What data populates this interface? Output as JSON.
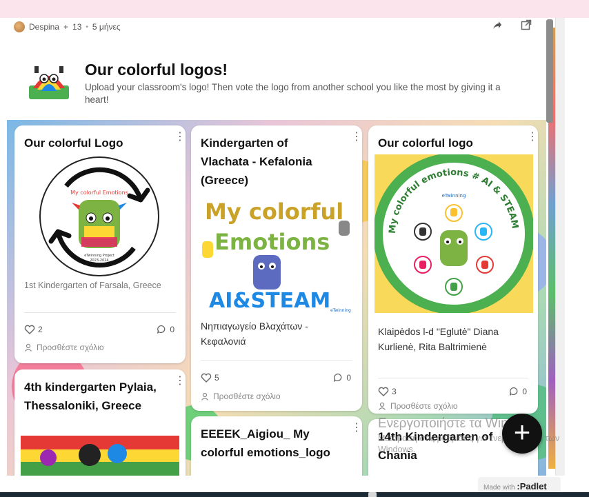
{
  "meta": {
    "author": "Despina",
    "plus": "+",
    "count": "13",
    "separator": "•",
    "age": "5 μήνες"
  },
  "header": {
    "title": "Our colorful logos!",
    "description": "Upload your classroom's logo! Then vote the logo from another school you like the most by giving it a heart!"
  },
  "cards": [
    {
      "title": "Our colorful Logo",
      "caption": "1st Kindergarten of Farsala, Greece",
      "likes": "2",
      "comments": "0",
      "comment_placeholder": "Προσθέστε σχόλιο",
      "logo_text": {
        "line1": "My colorful Emotions",
        "line2": "eTwinning Project",
        "line3": "2023-2024"
      }
    },
    {
      "title": "Kindergarten of Vlachata - Kefalonia (Greece)",
      "caption": "Νηπιαγωγείο Βλαχάτων - Κεφαλονιά",
      "likes": "5",
      "comments": "0",
      "comment_placeholder": "Προσθέστε σχόλιο",
      "logo_text": {
        "line1": "My colorful",
        "line2": "Emotions",
        "line3": "AI&STEAM",
        "badge": "eTwinning"
      }
    },
    {
      "title": "Our colorful logo",
      "caption": "Klaipėdos l-d \"Eglutė\" Diana Kurlienė, Rita Baltrimienė",
      "likes": "3",
      "comments": "0",
      "comment_placeholder": "Προσθέστε σχόλιο",
      "logo_text": {
        "arc": "My colorful emotions # AI & STEAM",
        "badge": "eTwinning"
      }
    },
    {
      "title": "4th kindergarten Pylaia, Thessaloniki, Greece"
    },
    {
      "title": "EEEEK_Aigiou_ My colorful emotions_logo"
    },
    {
      "title": "14th Kindergarten of Chania"
    }
  ],
  "fab": {
    "label": "+"
  },
  "watermark": {
    "line1": "Ενεργοποιήστε τα Windows",
    "line2": "Μετάβαση στις ρυθμίσεις για ενεργοποίηση των Windows."
  },
  "footer": {
    "made_with": "Made with",
    "brand": ":Padlet"
  },
  "colors": {
    "card_bg": "#ffffff",
    "fab": "#111111",
    "accent_yellow": "#f9d95a",
    "taskbar": "#1c2a36"
  }
}
